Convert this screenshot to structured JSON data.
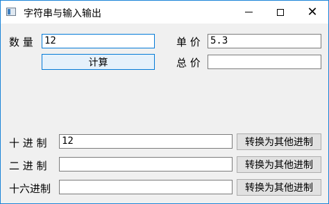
{
  "window": {
    "title": "字符串与输入输出",
    "minimize_icon": "minimize-icon",
    "maximize_icon": "maximize-icon",
    "close_icon": "close-icon",
    "close_glyph": "✕"
  },
  "form": {
    "quantity_label": "数 量",
    "quantity_value": "12",
    "unit_price_label": "单 价",
    "unit_price_value": "5.3",
    "calculate_button": "计算",
    "total_label": "总 价",
    "total_value": "",
    "decimal_label": "十 进 制",
    "decimal_value": "12",
    "binary_label": "二 进 制",
    "binary_value": "",
    "hex_label": "十六进制",
    "hex_value": "",
    "convert_button": "转换为其他进制"
  },
  "colors": {
    "accent": "#0078d7",
    "window_border": "#1883d7",
    "background": "#f0f0f0"
  }
}
